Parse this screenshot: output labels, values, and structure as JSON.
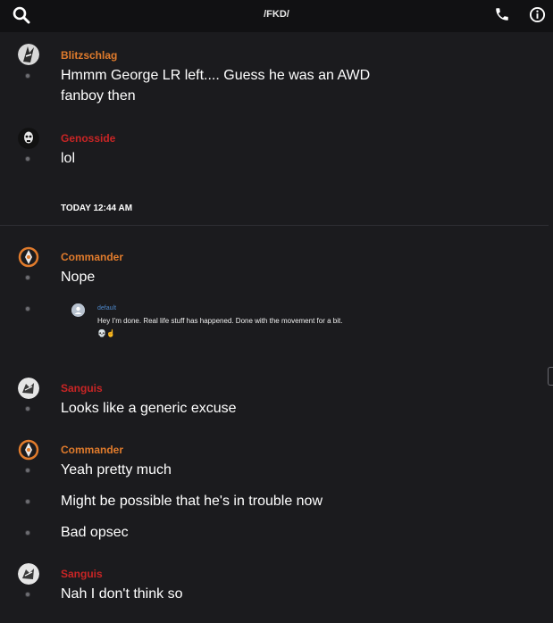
{
  "topbar": {
    "title": "/FKD/",
    "icons": [
      "search-icon",
      "phone-icon",
      "info-icon"
    ]
  },
  "colors": {
    "orange": "#e07b2c",
    "red": "#c92525",
    "background": "#1b1b1e",
    "topbar": "#111113"
  },
  "day_separator": "TODAY 12:44 AM",
  "messages": [
    {
      "user": "Blitzschlag",
      "user_color": "#e07b2c",
      "lines": [
        "Hmmm George LR left.... Guess he was an AWD",
        "fanboy then"
      ]
    },
    {
      "user": "Genosside",
      "user_color": "#c92525",
      "lines": [
        "lol"
      ]
    },
    {
      "user": "Commander",
      "user_color": "#e07b2c",
      "lines": [
        "Nope"
      ]
    },
    {
      "user": "Sanguis",
      "user_color": "#c92525",
      "lines": [
        "Looks like a generic excuse"
      ]
    },
    {
      "user": "Commander",
      "user_color": "#e07b2c",
      "lines": [
        "Yeah pretty much",
        "Might be possible that he's in trouble now",
        "Bad opsec"
      ]
    },
    {
      "user": "Sanguis",
      "user_color": "#c92525",
      "lines": [
        "Nah I don't think so"
      ]
    }
  ],
  "quote": {
    "user": "default",
    "text": "Hey I'm done. Real life stuff has happened. Done with the movement for a bit.",
    "emoji": "💀☝"
  }
}
